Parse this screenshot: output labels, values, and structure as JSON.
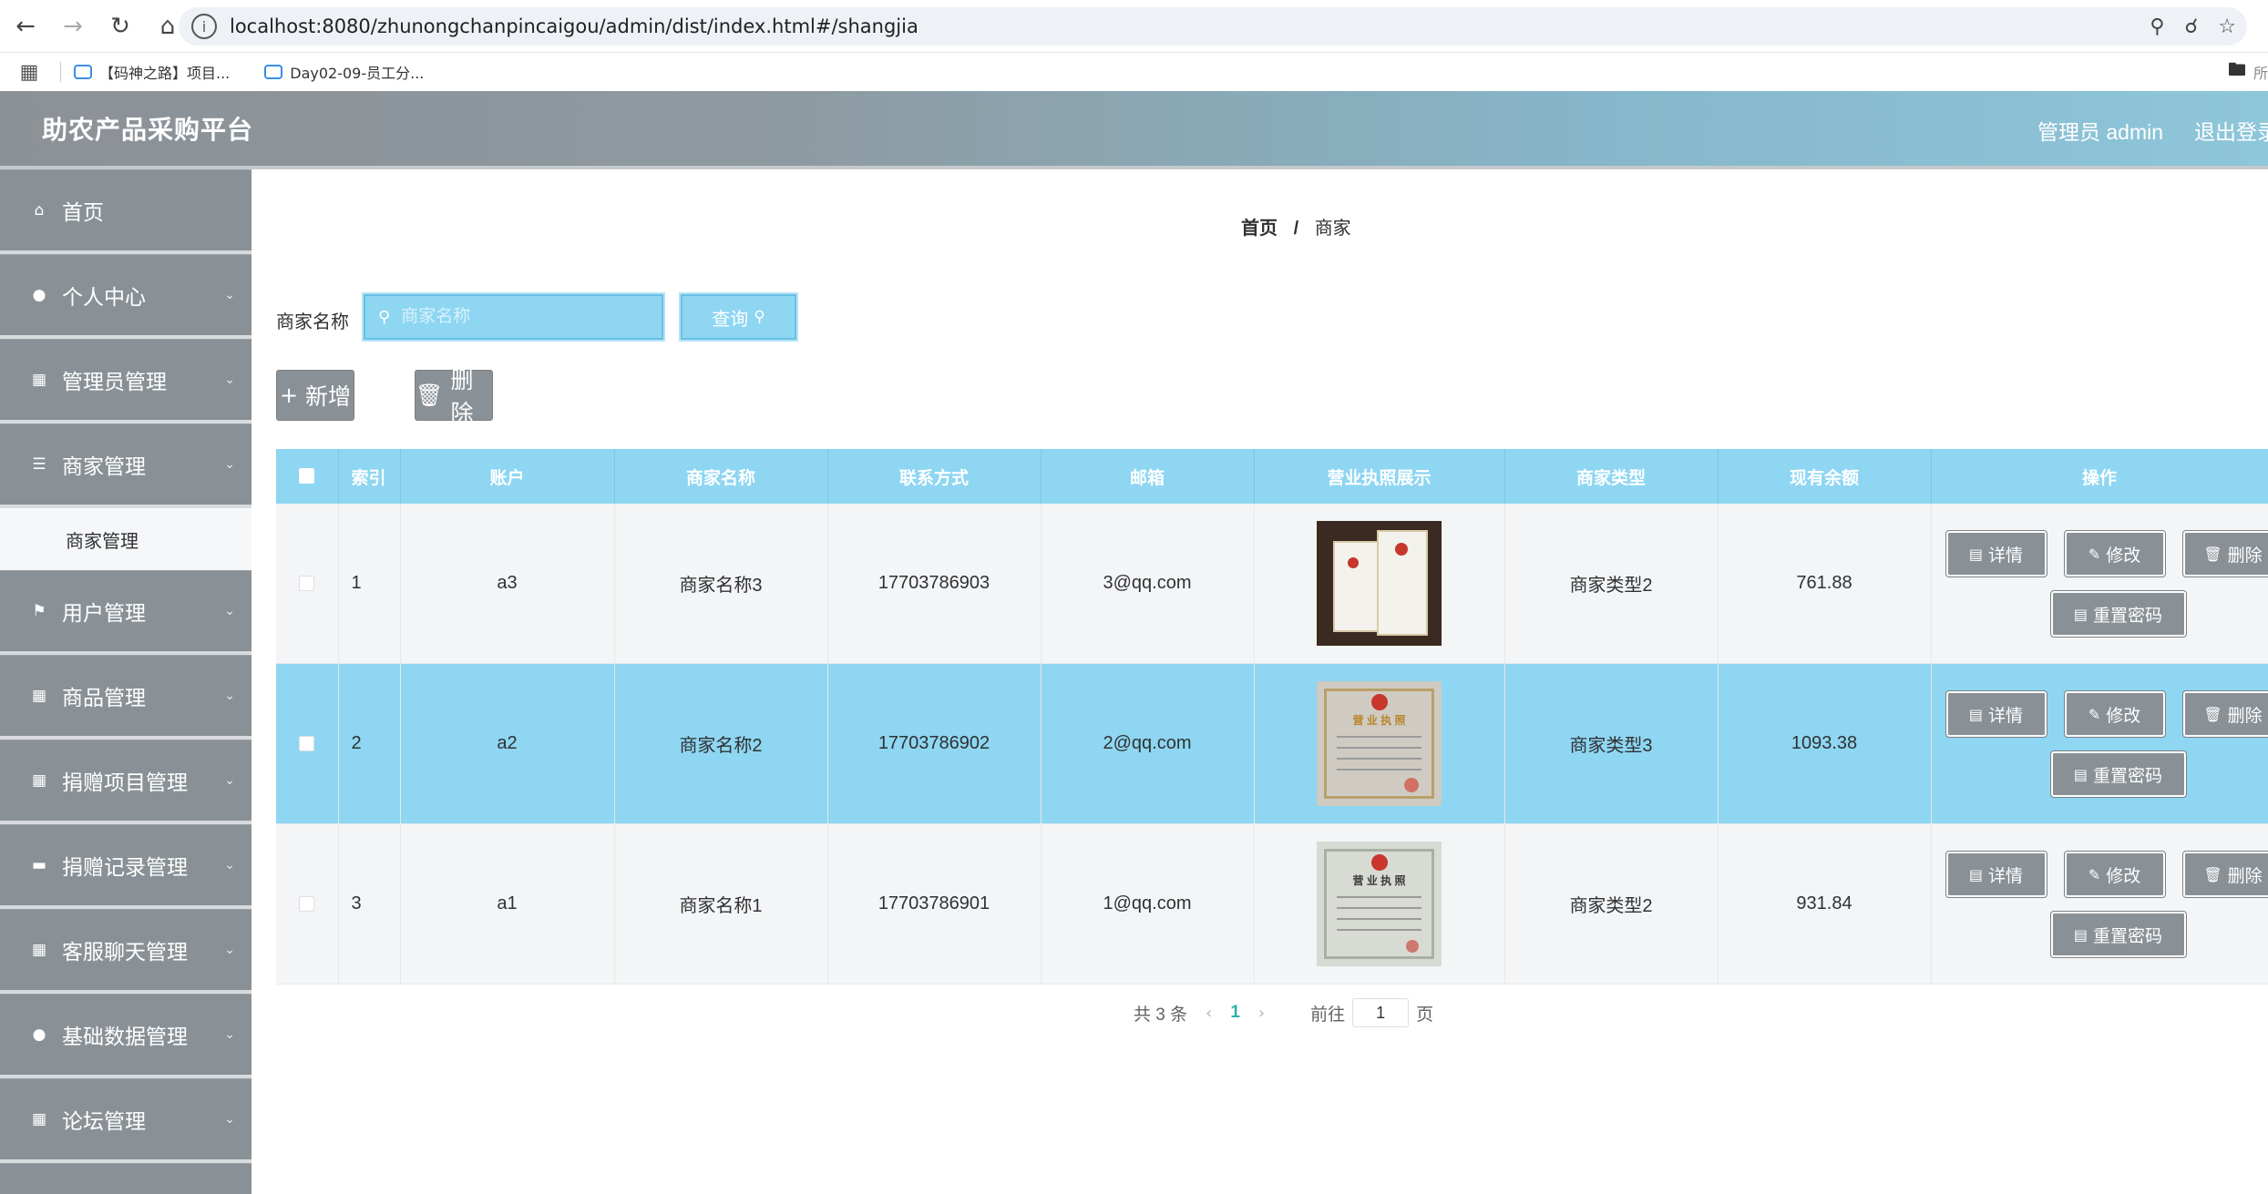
{
  "browser": {
    "url": "localhost:8080/zhunongchanpincaigou/admin/dist/index.html#/shangjia",
    "bookmarks": [
      "【码神之路】项目...",
      "Day02-09-员工分..."
    ],
    "folder_label": "所"
  },
  "header": {
    "title": "助农产品采购平台",
    "user": "管理员 admin",
    "logout": "退出登录"
  },
  "sidebar": {
    "items": [
      {
        "label": "首页",
        "icon": "home-icon",
        "has_chevron": false
      },
      {
        "label": "个人中心",
        "icon": "user-icon",
        "has_chevron": true
      },
      {
        "label": "管理员管理",
        "icon": "grid-icon",
        "has_chevron": true
      },
      {
        "label": "商家管理",
        "icon": "menu-icon",
        "has_chevron": true,
        "expanded": true
      },
      {
        "label": "用户管理",
        "icon": "flag-icon",
        "has_chevron": true
      },
      {
        "label": "商品管理",
        "icon": "grid-icon",
        "has_chevron": true
      },
      {
        "label": "捐赠项目管理",
        "icon": "grid-icon",
        "has_chevron": true
      },
      {
        "label": "捐赠记录管理",
        "icon": "ticket-icon",
        "has_chevron": true
      },
      {
        "label": "客服聊天管理",
        "icon": "grid-icon",
        "has_chevron": true
      },
      {
        "label": "基础数据管理",
        "icon": "user-icon",
        "has_chevron": true
      },
      {
        "label": "论坛管理",
        "icon": "grid-icon",
        "has_chevron": true
      }
    ],
    "submenu_label": "商家管理"
  },
  "breadcrumb": {
    "home": "首页",
    "separator": "/",
    "current": "商家"
  },
  "search": {
    "label": "商家名称",
    "placeholder": "商家名称",
    "value": "",
    "query_button": "查询"
  },
  "actions": {
    "add": "新增",
    "delete": "删除"
  },
  "table": {
    "columns": [
      "索引",
      "账户",
      "商家名称",
      "联系方式",
      "邮箱",
      "营业执照展示",
      "商家类型",
      "现有余额",
      "操作"
    ],
    "rows": [
      {
        "index": "1",
        "account": "a3",
        "name": "商家名称3",
        "phone": "17703786903",
        "email": "3@qq.com",
        "type": "商家类型2",
        "balance": "761.88"
      },
      {
        "index": "2",
        "account": "a2",
        "name": "商家名称2",
        "phone": "17703786902",
        "email": "2@qq.com",
        "type": "商家类型3",
        "balance": "1093.38"
      },
      {
        "index": "3",
        "account": "a1",
        "name": "商家名称1",
        "phone": "17703786901",
        "email": "1@qq.com",
        "type": "商家类型2",
        "balance": "931.84"
      }
    ],
    "row_buttons": {
      "detail": "详情",
      "edit": "修改",
      "delete": "删除",
      "reset": "重置密码"
    }
  },
  "pagination": {
    "total": "共 3 条",
    "current_page": "1",
    "goto_label": "前往",
    "goto_value": "1",
    "page_suffix": "页"
  },
  "colors": {
    "accent": "#8ed6f2",
    "sidebar": "#8a9196",
    "page_active": "#2bb3a8"
  }
}
